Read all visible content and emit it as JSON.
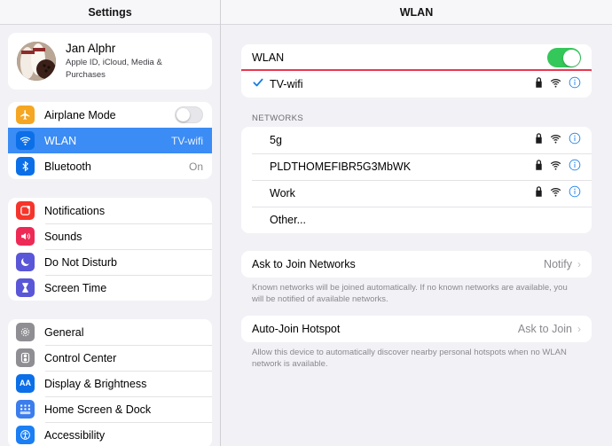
{
  "sidebar": {
    "header_title": "Settings",
    "profile": {
      "name": "Jan Alphr",
      "subtitle": "Apple ID, iCloud, Media & Purchases",
      "avatar_icon": "bowling-photo-avatar"
    },
    "group_connectivity": [
      {
        "label": "Airplane Mode",
        "icon": "airplane-icon",
        "color": "#f5a623",
        "control": "toggle-off",
        "value": ""
      },
      {
        "label": "WLAN",
        "icon": "wifi-icon",
        "color": "#007aff",
        "control": "value",
        "value": "TV-wifi",
        "selected": true
      },
      {
        "label": "Bluetooth",
        "icon": "bluetooth-icon",
        "color": "#007aff",
        "control": "value",
        "value": "On"
      }
    ],
    "group_alerts": [
      {
        "label": "Notifications",
        "icon": "notifications-icon",
        "color": "#f5352b"
      },
      {
        "label": "Sounds",
        "icon": "speaker-icon",
        "color": "#ed2a55"
      },
      {
        "label": "Do Not Disturb",
        "icon": "moon-icon",
        "color": "#5a56d8"
      },
      {
        "label": "Screen Time",
        "icon": "hourglass-icon",
        "color": "#5a56d8"
      }
    ],
    "group_system": [
      {
        "label": "General",
        "icon": "gear-icon",
        "color": "#8e8e93"
      },
      {
        "label": "Control Center",
        "icon": "sliders-icon",
        "color": "#8e8e93"
      },
      {
        "label": "Display & Brightness",
        "icon": "aa-icon",
        "color": "#007aff"
      },
      {
        "label": "Home Screen & Dock",
        "icon": "app-grid-icon",
        "color": "#3b7ded"
      },
      {
        "label": "Accessibility",
        "icon": "accessibility-icon",
        "color": "#1a7ef5"
      }
    ]
  },
  "main": {
    "header_title": "WLAN",
    "wlan_toggle": {
      "label": "WLAN",
      "state": "on"
    },
    "connected_network": {
      "name": "TV-wifi",
      "checked": true,
      "locked": true,
      "signal": "wifi-icon",
      "info": "info-icon",
      "highlighted": true,
      "highlight_color": "#e8384f"
    },
    "networks_header": "NETWORKS",
    "networks": [
      {
        "name": "5g",
        "locked": true,
        "signal": "wifi-icon",
        "info": "info-icon"
      },
      {
        "name": "PLDTHOMEFIBR5G3MbWK",
        "locked": true,
        "signal": "wifi-icon",
        "info": "info-icon"
      },
      {
        "name": "Work",
        "locked": true,
        "signal": "wifi-icon",
        "info": "info-icon"
      },
      {
        "name": "Other...",
        "locked": false,
        "signal": "",
        "info": ""
      }
    ],
    "ask_to_join": {
      "label": "Ask to Join Networks",
      "value": "Notify",
      "footer": "Known networks will be joined automatically. If no known networks are available, you will be notified of available networks."
    },
    "auto_join_hotspot": {
      "label": "Auto-Join Hotspot",
      "value": "Ask to Join",
      "footer": "Allow this device to automatically discover nearby personal hotspots when no WLAN network is available."
    }
  }
}
